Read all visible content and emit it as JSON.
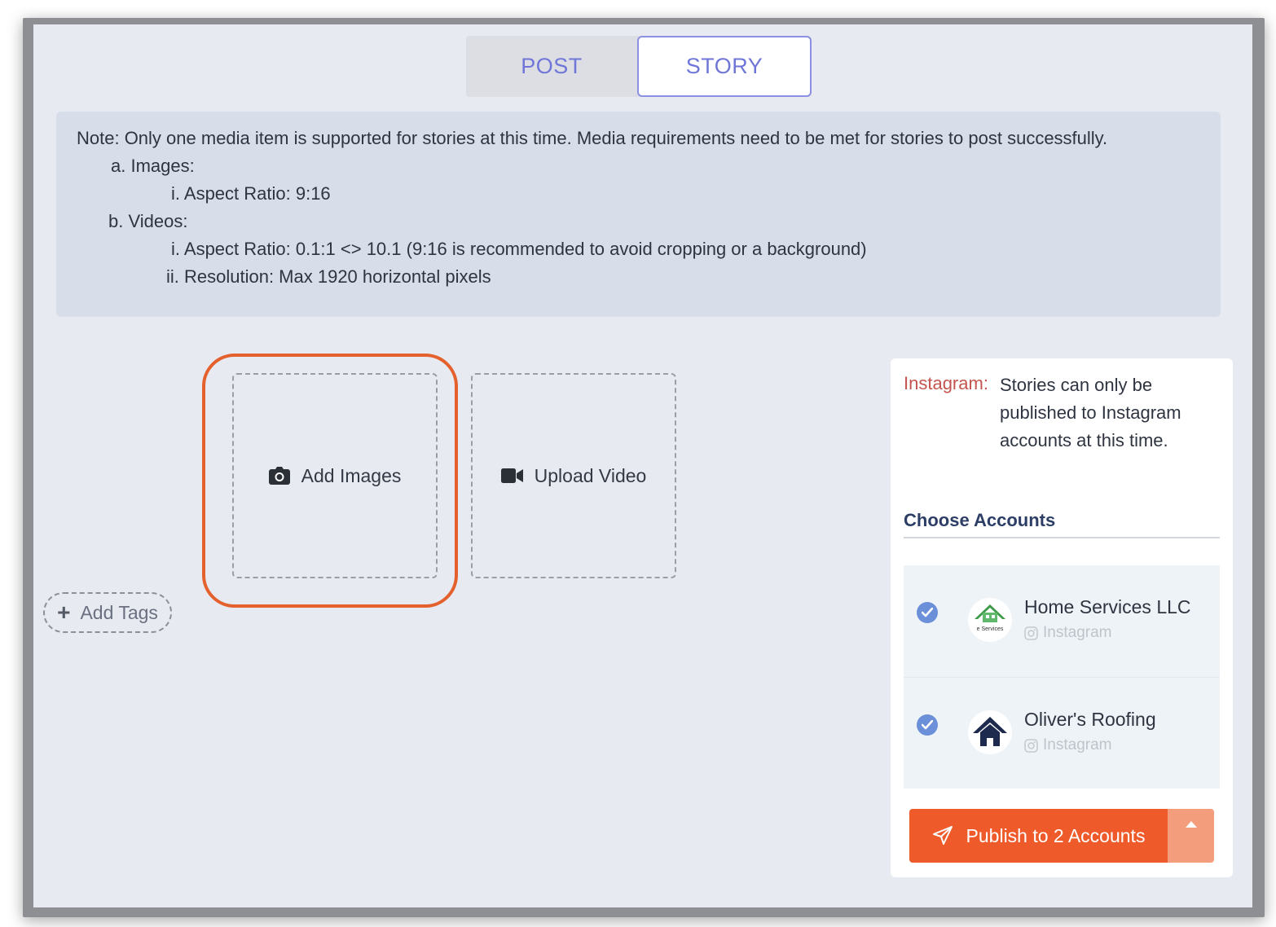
{
  "tabs": {
    "post": "POST",
    "story": "STORY",
    "active": "STORY"
  },
  "note": {
    "line1": "Note: Only one media item is supported for stories at this time. Media requirements need to be met for stories to post successfully.",
    "images_heading": "a. Images:",
    "images_aspect": "i. Aspect Ratio: 9:16",
    "videos_heading": "b. Videos:",
    "videos_aspect": "i. Aspect Ratio: 0.1:1 <> 10.1 (9:16 is recommended to avoid cropping or a background)",
    "videos_resolution": "ii. Resolution: Max 1920 horizontal pixels"
  },
  "media": {
    "add_images": "Add Images",
    "upload_video": "Upload Video",
    "add_images_icon": "camera-icon",
    "upload_video_icon": "video-camera-icon"
  },
  "tags": {
    "add_label": "Add Tags",
    "icon": "plus-icon"
  },
  "panel": {
    "platform_label": "Instagram:",
    "platform_message": "Stories can only be published to Instagram accounts at this time.",
    "choose_heading": "Choose Accounts",
    "accounts": [
      {
        "name": "Home Services LLC",
        "network": "Instagram",
        "selected": true,
        "logo_text": "e Services"
      },
      {
        "name": "Oliver's Roofing",
        "network": "Instagram",
        "selected": true
      }
    ],
    "publish_label": "Publish to 2 Accounts"
  },
  "colors": {
    "accent": "#ee5a2a",
    "tab_text": "#6f76d8",
    "highlight": "#e4602c",
    "instagram_label": "#c4544f",
    "check": "#6b8fd8"
  }
}
